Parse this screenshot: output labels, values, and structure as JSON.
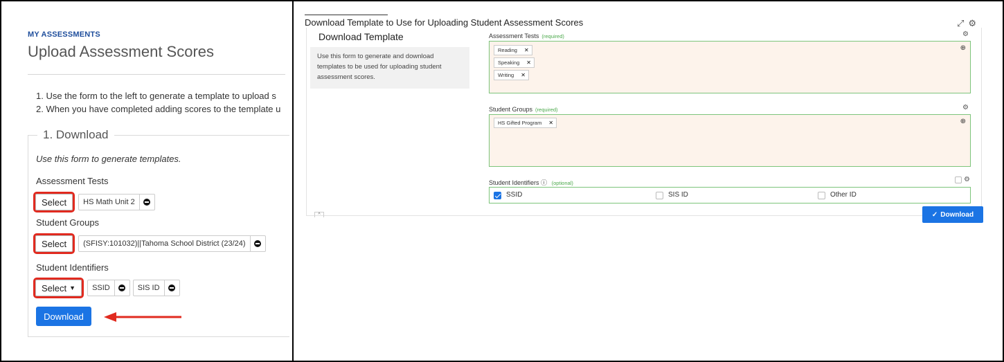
{
  "left": {
    "eyebrow": "MY ASSESSMENTS",
    "title": "Upload Assessment Scores",
    "instructions": [
      "1. Use the form to the left to generate a template to upload s",
      "2. When you have completed adding scores to the template u"
    ],
    "legend": "1. Download",
    "intro": "Use this form to generate templates.",
    "assessment_tests": {
      "label": "Assessment Tests",
      "select_label": "Select",
      "chips": [
        "HS Math Unit 2"
      ]
    },
    "student_groups": {
      "label": "Student Groups",
      "select_label": "Select",
      "chips": [
        "(SFISY:101032)||Tahoma School District (23/24)"
      ]
    },
    "student_identifiers": {
      "label": "Student Identifiers",
      "select_label": "Select",
      "chips": [
        "SSID",
        "SIS ID"
      ]
    },
    "download_label": "Download",
    "highlight_color": "#e12a1f",
    "accent_color": "#1b74e4"
  },
  "right": {
    "title": "Download Template to Use for Uploading Student Assessment Scores",
    "heading": "Download Template",
    "info_text": "Use this form to generate and download templates to be used for uploading student assessment scores.",
    "assessment_tests": {
      "label": "Assessment Tests",
      "required": "(required)",
      "tags": [
        "Reading",
        "Speaking",
        "Writing"
      ]
    },
    "student_groups": {
      "label": "Student Groups",
      "required": "(required)",
      "tags": [
        "HS Gifted Program"
      ]
    },
    "student_identifiers": {
      "label": "Student Identifiers",
      "optional": "(optional)",
      "options": [
        {
          "label": "SSID",
          "checked": true
        },
        {
          "label": "SIS ID",
          "checked": false
        },
        {
          "label": "Other ID",
          "checked": false
        }
      ]
    },
    "download_label": "Download",
    "icons": [
      "expand-icon",
      "gear-icon",
      "zoom-icon",
      "info-icon",
      "check-icon",
      "close-icon"
    ]
  }
}
